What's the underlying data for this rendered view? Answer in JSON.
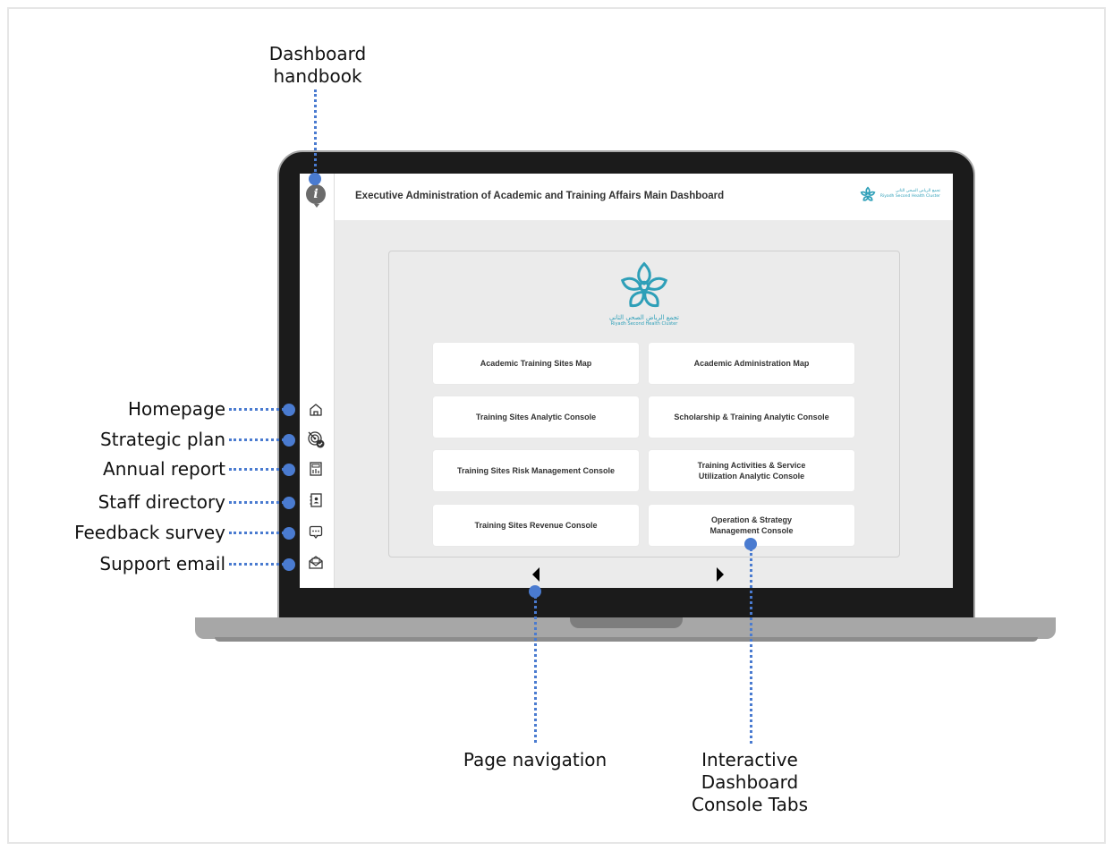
{
  "annotations": {
    "handbook": "Dashboard\nhandbook",
    "homepage": "Homepage",
    "strategic_plan": "Strategic plan",
    "annual_report": "Annual report",
    "staff_directory": "Staff directory",
    "feedback_survey": "Feedback survey",
    "support_email": "Support email",
    "page_navigation": "Page navigation",
    "console_tabs": "Interactive\nDashboard\nConsole Tabs"
  },
  "header": {
    "title": "Executive Administration of Academic and Training Affairs Main Dashboard",
    "brand_ar": "تجمع الرياض الصحي الثاني",
    "brand_en": "Riyadh Second Health Cluster"
  },
  "logo": {
    "arabic": "تجمع الرياض الصحي الثاني",
    "english": "Riyadh Second Health Cluster"
  },
  "consoles": [
    "Academic Training Sites Map",
    "Academic Administration Map",
    "Training Sites Analytic Console",
    "Scholarship & Training Analytic Console",
    "Training Sites Risk Management Console",
    "Training Activities & Service\nUtilization Analytic Console",
    "Training Sites Revenue Console",
    "Operation & Strategy\nManagement Console"
  ],
  "sidebar_icons": [
    "info-icon",
    "home-icon",
    "target-icon",
    "calculator-icon",
    "contacts-icon",
    "chat-icon",
    "mail-icon"
  ],
  "colors": {
    "accent": "#4a7bd0",
    "brand": "#2e9fb8"
  }
}
